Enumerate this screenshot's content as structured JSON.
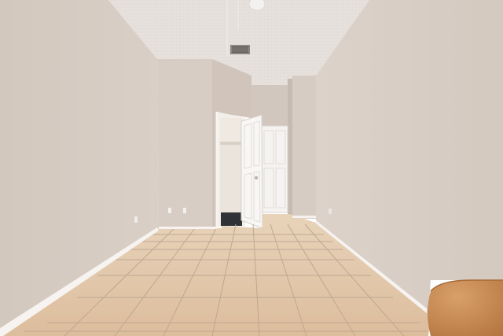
{
  "scene": {
    "description_items": [
      "textured-ceiling",
      "ceiling-fan",
      "air-vent",
      "left-wall",
      "right-wall",
      "open-white-door",
      "closet-doorway",
      "tile-floor",
      "wooden-table-edge"
    ],
    "colors": {
      "wall": "#d6cbc2",
      "wall_shadow": "#c9bdb3",
      "ceiling": "#e4dfda",
      "floor_tile": "#e2c6a8",
      "grout": "#b9a48f",
      "baseboard": "#f4f1ee",
      "door": "#f7f6f4",
      "table": "#c98b52"
    }
  }
}
